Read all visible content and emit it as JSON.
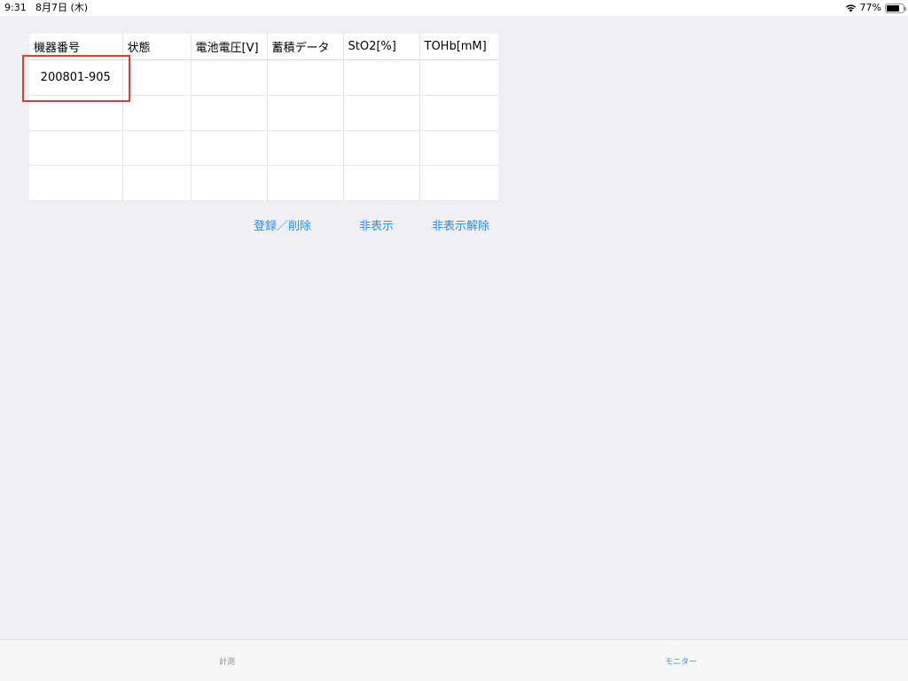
{
  "status_bar": {
    "time": "9:31",
    "date": "8月7日 (木)",
    "battery_percent": "77%",
    "battery_level": 0.77,
    "wifi_icon": "wifi-icon",
    "battery_icon": "battery-icon"
  },
  "table": {
    "headers": [
      "機器番号",
      "状態",
      "電池電圧[V]",
      "蓄積データ",
      "StO2[%]",
      "TOHb[mM]"
    ],
    "rows": [
      [
        "200801-905",
        "",
        "",
        "",
        "",
        ""
      ],
      [
        "",
        "",
        "",
        "",
        "",
        ""
      ],
      [
        "",
        "",
        "",
        "",
        "",
        ""
      ],
      [
        "",
        "",
        "",
        "",
        "",
        ""
      ]
    ]
  },
  "actions": {
    "register_delete": "登録／削除",
    "hide": "非表示",
    "unhide": "非表示解除"
  },
  "tab_bar": {
    "tabs": [
      {
        "label": "計測",
        "selected": false
      },
      {
        "label": "モニター",
        "selected": true
      }
    ]
  },
  "colors": {
    "accent": "#2a8ef2",
    "highlight": "#e53935",
    "background": "#efeff4"
  }
}
